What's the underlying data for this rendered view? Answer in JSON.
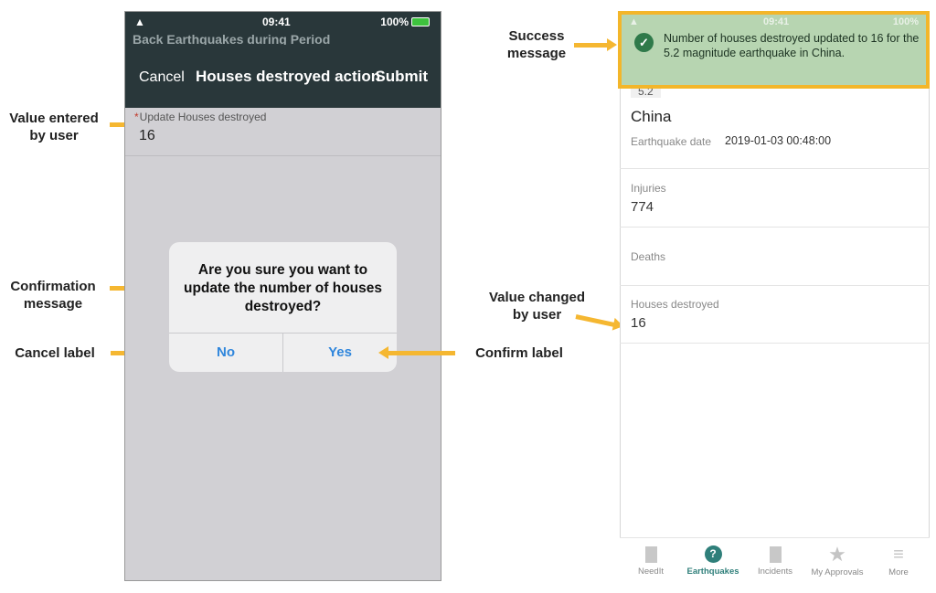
{
  "callouts": {
    "value_entered": "Value entered\nby user",
    "confirmation_message": "Confirmation\nmessage",
    "cancel_label": "Cancel label",
    "confirm_label": "Confirm label",
    "success_message": "Success\nmessage",
    "value_changed": "Value changed\nby user"
  },
  "left_phone": {
    "status": {
      "time": "09:41",
      "battery": "100%"
    },
    "back_row": "Back  Earthquakes during Period",
    "nav": {
      "cancel": "Cancel",
      "title": "Houses destroyed action",
      "submit": "Submit"
    },
    "field": {
      "required_mark": "*",
      "label": "Update Houses destroyed",
      "value": "16"
    },
    "dialog": {
      "message": "Are you sure you want to update the number of houses destroyed?",
      "no_label": "No",
      "yes_label": "Yes"
    }
  },
  "right_phone": {
    "status": {
      "time": "09:41",
      "battery": "100%"
    },
    "toast": "Number of houses destroyed  updated to 16 for the 5.2 magnitude earthquake in China.",
    "magnitude": "5.2",
    "location": "China",
    "earthquake_date_label": "Earthquake date",
    "earthquake_date_value": "2019-01-03 00:48:00",
    "injuries_label": "Injuries",
    "injuries_value": "774",
    "deaths_label": "Deaths",
    "houses_destroyed_label": "Houses destroyed",
    "houses_destroyed_value": "16",
    "tabs": [
      {
        "label": "NeedIt",
        "icon": "document-icon"
      },
      {
        "label": "Earthquakes",
        "icon": "help-circle-icon"
      },
      {
        "label": "Incidents",
        "icon": "document-icon"
      },
      {
        "label": "My Approvals",
        "icon": "star-icon"
      },
      {
        "label": "More",
        "icon": "menu-icon"
      }
    ]
  },
  "colors": {
    "accent_arrow": "#f5b731",
    "nav_bar": "#29373a",
    "toast_bg": "#b7d5b1",
    "toast_border": "#f3b62a",
    "button_blue": "#2f86dc",
    "tab_active": "#2f7f7a"
  }
}
